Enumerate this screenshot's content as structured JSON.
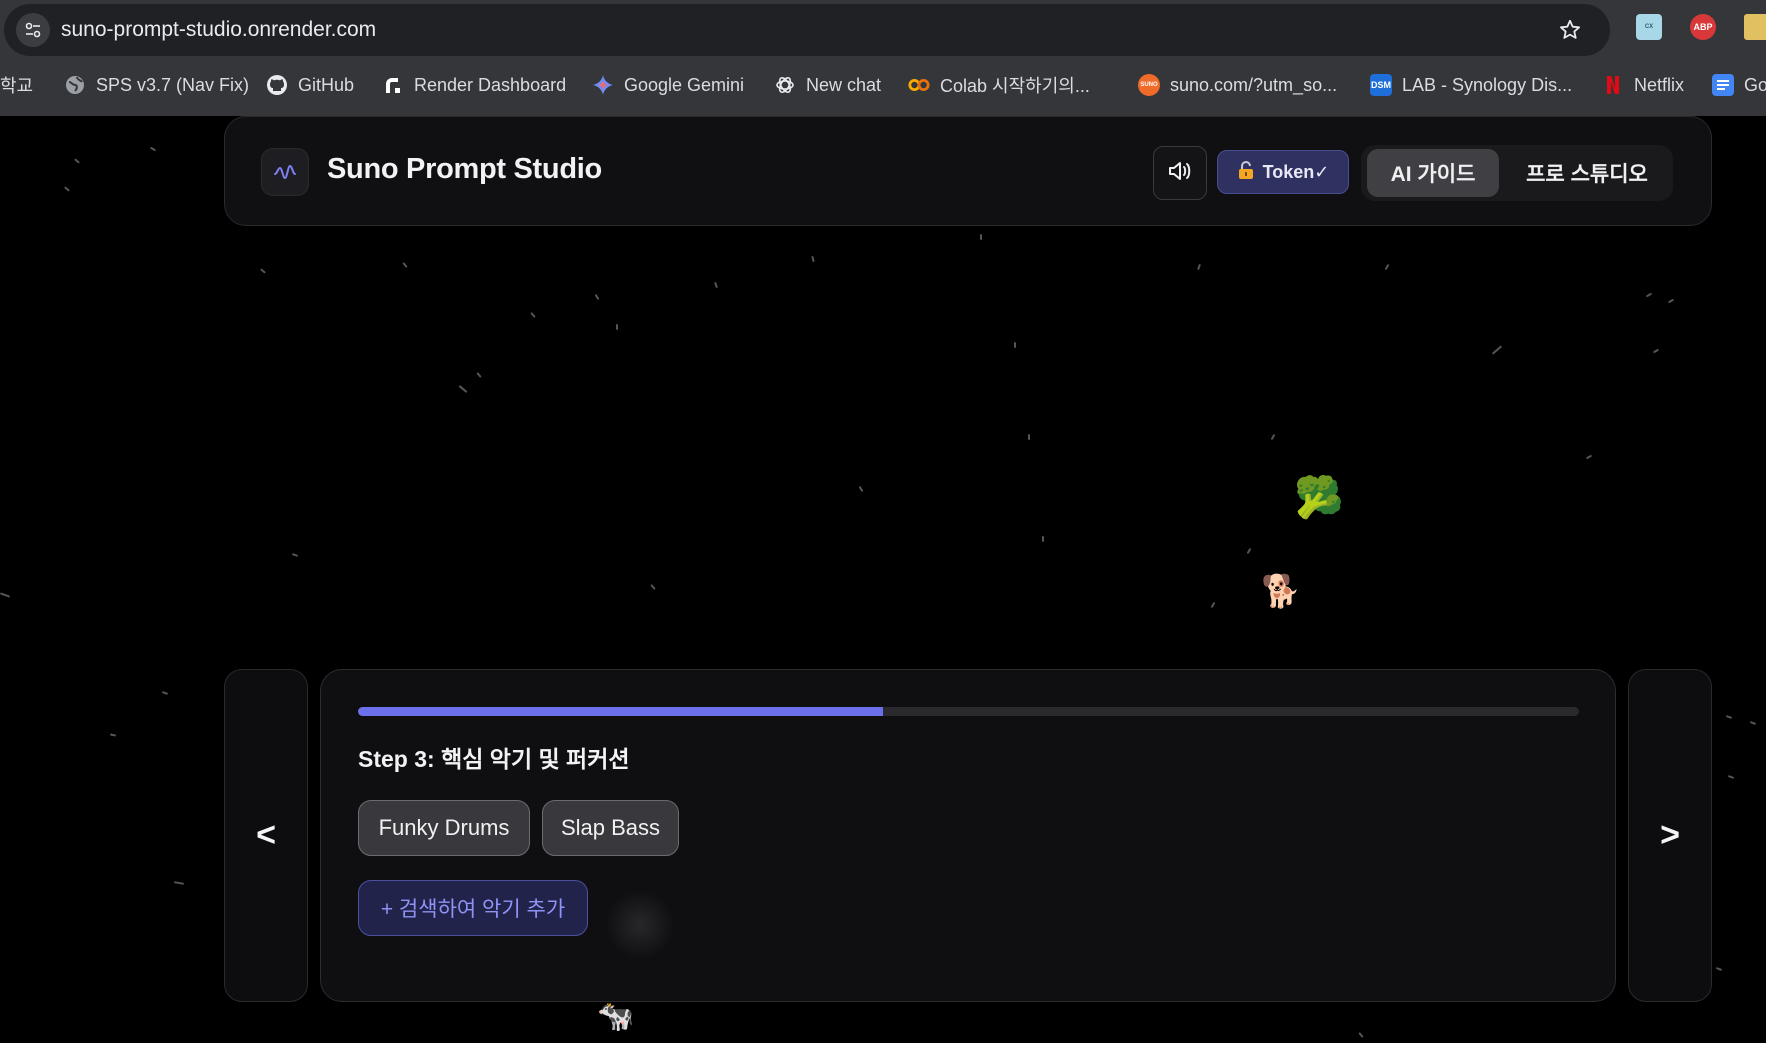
{
  "browser": {
    "url": "suno-prompt-studio.onrender.com",
    "bookmarks": [
      {
        "label": "학교",
        "icon": "none"
      },
      {
        "label": "SPS v3.7 (Nav Fix)",
        "icon": "globe-icon"
      },
      {
        "label": "GitHub",
        "icon": "github-icon"
      },
      {
        "label": "Render Dashboard",
        "icon": "render-icon"
      },
      {
        "label": "Google Gemini",
        "icon": "gemini-icon"
      },
      {
        "label": "New chat",
        "icon": "openai-icon"
      },
      {
        "label": "Colab 시작하기의...",
        "icon": "colab-icon"
      },
      {
        "label": "suno.com/?utm_so...",
        "icon": "suno-icon"
      },
      {
        "label": "LAB - Synology Dis...",
        "icon": "dsm-icon"
      },
      {
        "label": "Netflix",
        "icon": "netflix-icon"
      },
      {
        "label": "Go",
        "icon": "docs-icon"
      }
    ],
    "extensions": {
      "abp_label": "ABP",
      "dsm_label": "DSM",
      "suno_label": "SUNO"
    }
  },
  "app": {
    "title": "Suno Prompt Studio",
    "token_label": "Token✓",
    "mode_ai_label": "AI 가이드",
    "mode_pro_label": "프로 스튜디오",
    "active_mode": "AI 가이드",
    "accent_color": "#6c70ea"
  },
  "step": {
    "title": "Step 3: 핵심 악기 및 퍼커션",
    "progress": 0.43,
    "instruments": [
      "Funky Drums",
      "Slap Bass"
    ],
    "add_button_label": "+ 검색하여 악기 추가",
    "prev_label": "<",
    "next_label": ">"
  },
  "decorations": {
    "emoji_broccoli": "🥦",
    "emoji_dog": "🐕",
    "emoji_cow": "🐄"
  }
}
